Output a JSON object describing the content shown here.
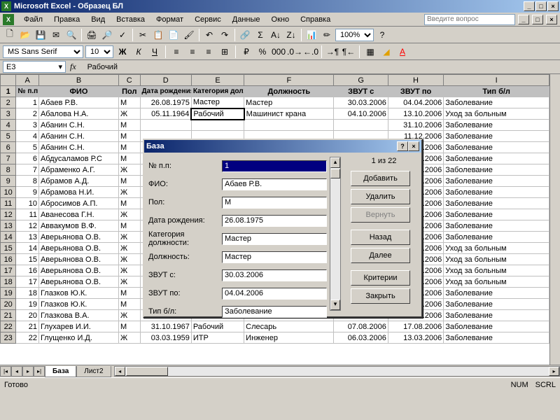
{
  "app": {
    "title": "Microsoft Excel - Образец БЛ"
  },
  "menu": {
    "file": "Файл",
    "edit": "Правка",
    "view": "Вид",
    "insert": "Вставка",
    "format": "Формат",
    "tools": "Сервис",
    "data": "Данные",
    "window": "Окно",
    "help": "Справка"
  },
  "question": {
    "placeholder": "Введите вопрос"
  },
  "format_bar": {
    "font": "MS Sans Serif",
    "size": "10",
    "zoom": "100%"
  },
  "namebox": {
    "cell": "E3",
    "fx": "fx",
    "formula": "Рабочий"
  },
  "columns": [
    "",
    "A",
    "B",
    "C",
    "D",
    "E",
    "F",
    "G",
    "H",
    "I"
  ],
  "headers": {
    "num": "№ п.п",
    "fio": "ФИО",
    "pol": "Пол",
    "dob": "Дата рождения",
    "cat": "Категория должности",
    "pos": "Должность",
    "zvut_s": "ЗВУТ с",
    "zvut_po": "ЗВУТ по",
    "type": "Тип б/л"
  },
  "rows": [
    {
      "n": "1",
      "fio": "Абаев Р.В.",
      "pol": "М",
      "dob": "26.08.1975",
      "cat": "Мастер",
      "pos": "Мастер",
      "zs": "30.03.2006",
      "zp": "04.04.2006",
      "t": "Заболевание"
    },
    {
      "n": "2",
      "fio": "Абалова Н.А.",
      "pol": "Ж",
      "dob": "05.11.1964",
      "cat": "Рабочий",
      "pos": "Машинист крана",
      "zs": "04.10.2006",
      "zp": "13.10.2006",
      "t": "Уход за больным"
    },
    {
      "n": "3",
      "fio": "Абанин С.Н.",
      "pol": "М",
      "dob": "",
      "cat": "",
      "pos": "",
      "zs": "",
      "zp": "31.10.2006",
      "t": "Заболевание"
    },
    {
      "n": "4",
      "fio": "Абанин С.Н.",
      "pol": "М",
      "dob": "",
      "cat": "",
      "pos": "",
      "zs": "",
      "zp": "11.12.2006",
      "t": "Заболевание"
    },
    {
      "n": "5",
      "fio": "Абанин С.Н.",
      "pol": "М",
      "dob": "",
      "cat": "",
      "pos": "",
      "zs": "",
      "zp": "10.11.2006",
      "t": "Заболевание"
    },
    {
      "n": "6",
      "fio": "Абдусаламов Р.С",
      "pol": "М",
      "dob": "",
      "cat": "",
      "pos": "",
      "zs": "",
      "zp": "24.11.2006",
      "t": "Заболевание"
    },
    {
      "n": "7",
      "fio": "Абраменко А.Г.",
      "pol": "Ж",
      "dob": "",
      "cat": "",
      "pos": "",
      "zs": "",
      "zp": "20.10.2006",
      "t": "Заболевание"
    },
    {
      "n": "8",
      "fio": "Абрамов А.Д.",
      "pol": "М",
      "dob": "",
      "cat": "",
      "pos": "",
      "zs": "",
      "zp": "19.09.2006",
      "t": "Заболевание"
    },
    {
      "n": "9",
      "fio": "Абрамова Н.И.",
      "pol": "Ж",
      "dob": "",
      "cat": "",
      "pos": "",
      "zs": "",
      "zp": "22.02.2006",
      "t": "Заболевание"
    },
    {
      "n": "10",
      "fio": "Абросимов А.П.",
      "pol": "М",
      "dob": "",
      "cat": "",
      "pos": "",
      "zs": "",
      "zp": "29.03.2006",
      "t": "Заболевание"
    },
    {
      "n": "11",
      "fio": "Аванесова Г.Н.",
      "pol": "Ж",
      "dob": "",
      "cat": "",
      "pos": "",
      "zs": "",
      "zp": "10.11.2006",
      "t": "Заболевание"
    },
    {
      "n": "12",
      "fio": "Аввакумов В.Ф.",
      "pol": "М",
      "dob": "",
      "cat": "",
      "pos": "",
      "zs": "",
      "zp": "22.06.2006",
      "t": "Заболевание"
    },
    {
      "n": "13",
      "fio": "Аверьянова О.В.",
      "pol": "Ж",
      "dob": "",
      "cat": "",
      "pos": "",
      "zs": "",
      "zp": "27.03.2006",
      "t": "Заболевание"
    },
    {
      "n": "14",
      "fio": "Аверьянова О.В.",
      "pol": "Ж",
      "dob": "",
      "cat": "",
      "pos": "",
      "zs": "",
      "zp": "10.03.2006",
      "t": "Уход за больным"
    },
    {
      "n": "15",
      "fio": "Аверьянова О.В.",
      "pol": "Ж",
      "dob": "",
      "cat": "",
      "pos": "",
      "zs": "",
      "zp": "19.04.2006",
      "t": "Уход за больным"
    },
    {
      "n": "16",
      "fio": "Аверьянова О.В.",
      "pol": "Ж",
      "dob": "",
      "cat": "",
      "pos": "",
      "zs": "",
      "zp": "03.11.2006",
      "t": "Уход за больным"
    },
    {
      "n": "17",
      "fio": "Аверьянова О.В.",
      "pol": "Ж",
      "dob": "",
      "cat": "",
      "pos": "",
      "zs": "",
      "zp": "17.10.2006",
      "t": "Уход за больным"
    },
    {
      "n": "18",
      "fio": "Глазков Ю.К.",
      "pol": "М",
      "dob": "",
      "cat": "",
      "pos": "",
      "zs": "",
      "zp": "15.11.2006",
      "t": "Заболевание"
    },
    {
      "n": "19",
      "fio": "Глазков Ю.К.",
      "pol": "М",
      "dob": "",
      "cat": "",
      "pos": "",
      "zs": "",
      "zp": "17.11.2006",
      "t": "Заболевание"
    },
    {
      "n": "20",
      "fio": "Глазкова В.А.",
      "pol": "Ж",
      "dob": "",
      "cat": "",
      "pos": "",
      "zs": "",
      "zp": "08.07.2006",
      "t": "Заболевание"
    },
    {
      "n": "21",
      "fio": "Глухарев И.И.",
      "pol": "М",
      "dob": "31.10.1967",
      "cat": "Рабочий",
      "pos": "Слесарь",
      "zs": "07.08.2006",
      "zp": "17.08.2006",
      "t": "Заболевание"
    },
    {
      "n": "22",
      "fio": "Глущенко И.Д.",
      "pol": "Ж",
      "dob": "03.03.1959",
      "cat": "ИТР",
      "pos": "Инженер",
      "zs": "06.03.2006",
      "zp": "13.03.2006",
      "t": "Заболевание"
    }
  ],
  "tabs": {
    "active": "База",
    "other": "Лист2"
  },
  "status": {
    "ready": "Готово",
    "num": "NUM",
    "scrl": "SCRL"
  },
  "dialog": {
    "title": "База",
    "counter": "1 из 22",
    "labels": {
      "num": "№ п.п:",
      "fio": "ФИО:",
      "pol": "Пол:",
      "dob": "Дата рождения:",
      "cat": "Категория должности:",
      "pos": "Должность:",
      "zs": "ЗВУТ с:",
      "zp": "ЗВУТ по:",
      "type": "Тип б/л:"
    },
    "values": {
      "num": "1",
      "fio": "Абаев Р.В.",
      "pol": "М",
      "dob": "26.08.1975",
      "cat": "Мастер",
      "pos": "Мастер",
      "zs": "30.03.2006",
      "zp": "04.04.2006",
      "type": "Заболевание"
    },
    "buttons": {
      "add": "Добавить",
      "del": "Удалить",
      "restore": "Вернуть",
      "back": "Назад",
      "next": "Далее",
      "criteria": "Критерии",
      "close": "Закрыть"
    }
  }
}
